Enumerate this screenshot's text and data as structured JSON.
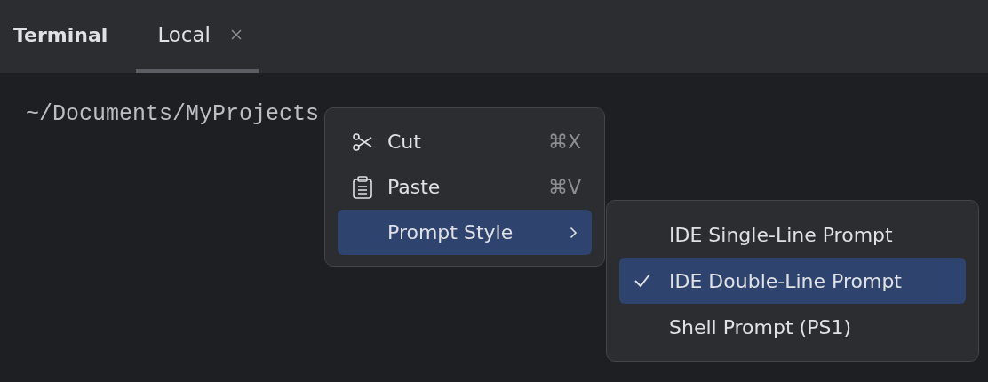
{
  "tool_window": {
    "title": "Terminal",
    "tabs": [
      {
        "label": "Local",
        "selected": true
      }
    ]
  },
  "terminal": {
    "lines": [
      "~/Documents/MyProjects"
    ]
  },
  "context_menu": {
    "items": [
      {
        "kind": "cut",
        "label": "Cut",
        "shortcut": "⌘X",
        "selected": false
      },
      {
        "kind": "paste",
        "label": "Paste",
        "shortcut": "⌘V",
        "selected": false
      },
      {
        "kind": "submenu",
        "label": "Prompt Style",
        "selected": true
      }
    ]
  },
  "submenu": {
    "items": [
      {
        "label": "IDE Single-Line Prompt",
        "checked": false,
        "selected": false
      },
      {
        "label": "IDE Double-Line Prompt",
        "checked": true,
        "selected": true
      },
      {
        "label": "Shell Prompt (PS1)",
        "checked": false,
        "selected": false
      }
    ]
  }
}
